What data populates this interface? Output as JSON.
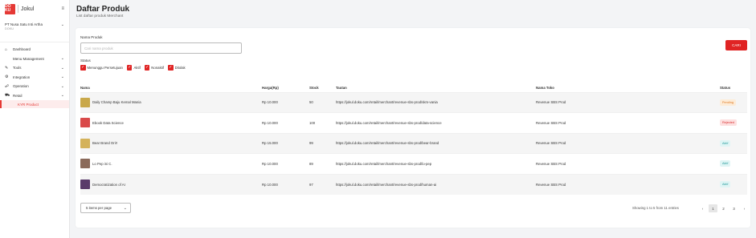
{
  "brand": {
    "logo_text": "DO KU",
    "name": "Jokul"
  },
  "merchant": {
    "name": "PT Nusa Satu Inti Artha",
    "sub": "DOKU"
  },
  "nav": [
    {
      "label": "Dashboard",
      "icon": "home-icon",
      "glyph": "⌂",
      "chevron": ""
    },
    {
      "label": "Menu Management",
      "icon": "menu-icon",
      "glyph": "",
      "chevron": "⌄"
    },
    {
      "label": "Tools",
      "icon": "wrench-icon",
      "glyph": "✎",
      "chevron": "⌄"
    },
    {
      "label": "Integration",
      "icon": "gear-icon",
      "glyph": "⚙",
      "chevron": "⌄"
    },
    {
      "label": "Operation",
      "icon": "binoculars-icon",
      "glyph": "☍",
      "chevron": "⌄"
    },
    {
      "label": "Retail",
      "icon": "cart-icon",
      "glyph": "⛟",
      "chevron": "⌄"
    }
  ],
  "nav_sub": {
    "label": "KYR Product"
  },
  "page": {
    "title": "Daftar Produk",
    "subtitle": "List daftar produk Merchant"
  },
  "filter": {
    "name_label": "Nama Produk",
    "search_placeholder": "Cari nama produk",
    "search_value": "",
    "cari_label": "CARI",
    "status_label": "Status",
    "statuses": [
      "Menunggu Persetujuan",
      "Aktif",
      "Nonaktif",
      "Ditolak"
    ]
  },
  "table": {
    "headers": [
      "Nama",
      "Harga(Rp)",
      "Stock",
      "Tautan",
      "Nama Toko",
      "Status"
    ],
    "rows": [
      {
        "name": "Daily Champ Baju Kemal Mania",
        "price": "Rp 10.000",
        "stock": "50",
        "link": "https://jokul.doku.com/retail/merchant/revenue-sbs-prod/skm-vania",
        "store": "Revenue SBS Prod",
        "status": "Pending",
        "status_bg": "#fdecd8",
        "status_fg": "#e07b24",
        "thumb": "#c9a84a"
      },
      {
        "name": "Ebook Data Science",
        "price": "Rp 10.000",
        "stock": "100",
        "link": "https://jokul.doku.com/retail/merchant/revenue-sbs-prod/data-science",
        "store": "Revenue SBS Prod",
        "status": "Rejected",
        "status_bg": "#fde0e0",
        "status_fg": "#d93030",
        "thumb": "#d94a4a"
      },
      {
        "name": "Bear Brand Ori!!",
        "price": "Rp 15.000",
        "stock": "99",
        "link": "https://jokul.doku.com/retail/merchant/revenue-sbs-prod/bear-brand",
        "store": "Revenue SBS Prod",
        "status": "Aktif",
        "status_bg": "#dff5f5",
        "status_fg": "#2a9d9d",
        "thumb": "#d4b25a"
      },
      {
        "name": "Lo Pep ini C.",
        "price": "Rp 10.000",
        "stock": "89",
        "link": "https://jokul.doku.com/retail/merchant/revenue-sbs-prod/lo-pep",
        "store": "Revenue SBS Prod",
        "status": "Aktif",
        "status_bg": "#dff5f5",
        "status_fg": "#2a9d9d",
        "thumb": "#8a6a5a"
      },
      {
        "name": "Democratization of AI",
        "price": "Rp 10.000",
        "stock": "97",
        "link": "https://jokul.doku.com/retail/merchant/revenue-sbs-prod/human-ai",
        "store": "Revenue SBS Prod",
        "status": "Aktif",
        "status_bg": "#dff5f5",
        "status_fg": "#2a9d9d",
        "thumb": "#5a3a6a"
      }
    ]
  },
  "footer": {
    "per_page": "5 items per page",
    "showing": "Showing 1 to 5 from 11 entries",
    "pages": [
      "‹",
      "1",
      "2",
      "3",
      "›"
    ],
    "active_page": "1"
  },
  "colors": {
    "accent": "#e02424"
  }
}
